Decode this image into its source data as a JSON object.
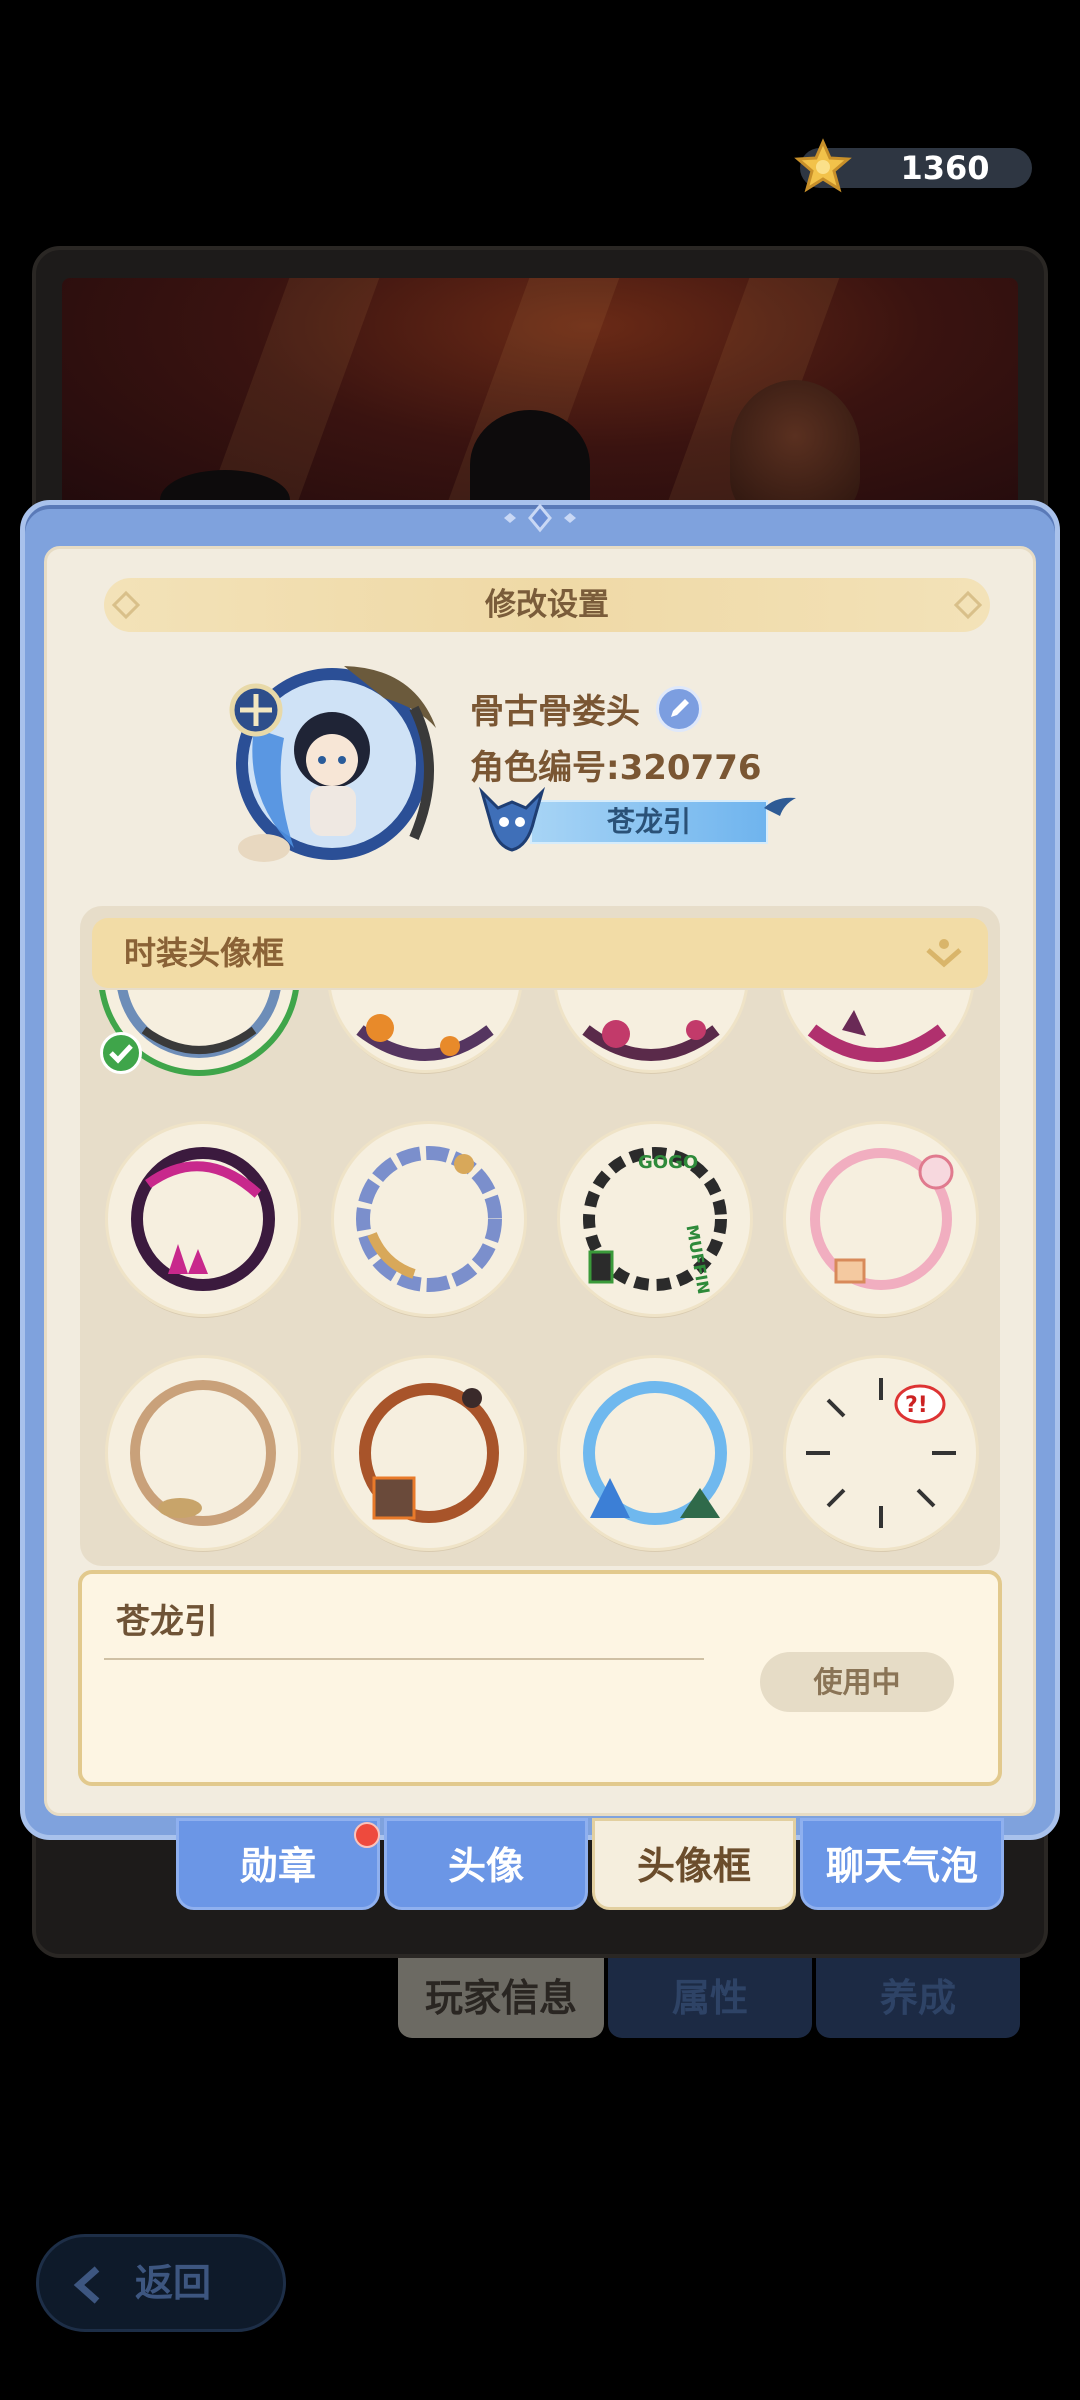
{
  "currency": {
    "value": "1360",
    "icon": "star-coin-icon"
  },
  "dialog": {
    "title": "修改设置"
  },
  "profile": {
    "name": "骨古骨娄头",
    "id_text": "角色编号:320776",
    "badge_label": "苍龙引"
  },
  "frames": {
    "header": "时装头像框",
    "items": [
      {
        "name": "dragon-frame",
        "selected": true
      },
      {
        "name": "pumpkin-frame"
      },
      {
        "name": "rose-frame"
      },
      {
        "name": "crystal-frame"
      },
      {
        "name": "dark-magic-frame"
      },
      {
        "name": "blue-chain-frame"
      },
      {
        "name": "gogo-muffin-frame",
        "text": "GOGO MUFFIN"
      },
      {
        "name": "cake-frame"
      },
      {
        "name": "wooden-frame"
      },
      {
        "name": "lava-frame"
      },
      {
        "name": "ice-frame"
      },
      {
        "name": "comic-frame",
        "text": "?!"
      }
    ]
  },
  "detail": {
    "title": "苍龙引",
    "button": "使用中"
  },
  "tabs": [
    {
      "label": "勋章",
      "has_badge": true
    },
    {
      "label": "头像"
    },
    {
      "label": "头像框",
      "active": true
    },
    {
      "label": "聊天气泡"
    }
  ],
  "background_tabs": [
    {
      "label": "玩家信息"
    },
    {
      "label": "属性"
    },
    {
      "label": "养成"
    }
  ],
  "back": {
    "label": "返回"
  }
}
